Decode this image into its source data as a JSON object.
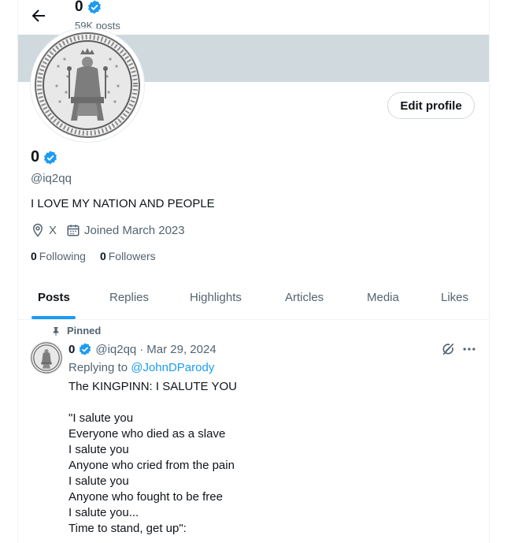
{
  "header": {
    "name": "0",
    "posts_count": "59K posts"
  },
  "profile": {
    "display_name": "0",
    "handle": "@iq2qq",
    "bio": "I LOVE MY NATION AND PEOPLE",
    "location": "X",
    "joined": "Joined March 2023",
    "following_count": "0",
    "following_label": "Following",
    "followers_count": "0",
    "followers_label": "Followers",
    "edit_button_label": "Edit profile"
  },
  "tabs": [
    {
      "label": "Posts",
      "active": true
    },
    {
      "label": "Replies",
      "active": false
    },
    {
      "label": "Highlights",
      "active": false
    },
    {
      "label": "Articles",
      "active": false
    },
    {
      "label": "Media",
      "active": false
    },
    {
      "label": "Likes",
      "active": false
    }
  ],
  "pinned_post": {
    "pinned_label": "Pinned",
    "author_name": "0",
    "author_handle": "@iq2qq",
    "separator": "·",
    "date": "Mar 29, 2024",
    "replying_prefix": "Replying to",
    "replying_to": "@JohnDParody",
    "lines": [
      "The KINGPINN: I SALUTE YOU",
      "",
      "\"I salute you",
      "Everyone who died as a slave",
      "I salute you",
      "Anyone who cried from the pain",
      "I salute you",
      "Anyone who fought to be free",
      "I salute you...",
      "Time to stand, get up\":"
    ]
  },
  "icons": {
    "back": "arrow-left-icon",
    "verified": "verified-badge-icon",
    "location": "location-pin-icon",
    "calendar": "calendar-icon",
    "pin": "pin-icon",
    "grok": "grok-icon",
    "more": "more-dots-icon"
  },
  "colors": {
    "accent": "#1d9bf0",
    "text": "#0f1419",
    "muted": "#536471",
    "banner": "#cfd9de"
  }
}
